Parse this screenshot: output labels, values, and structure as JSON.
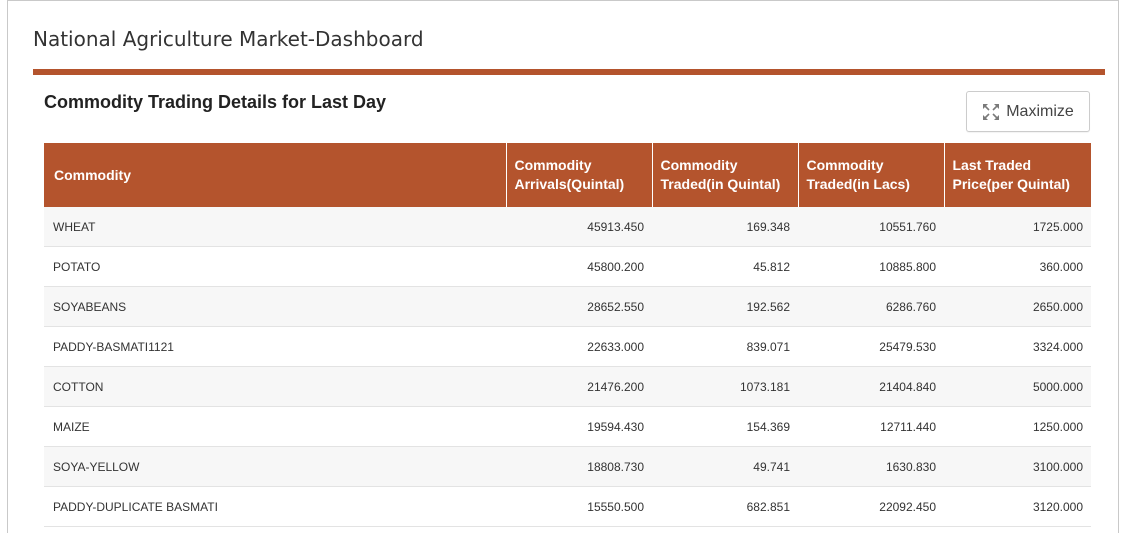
{
  "page": {
    "title": "National Agriculture Market-Dashboard"
  },
  "panel": {
    "title": "Commodity Trading Details for Last Day",
    "maximize_label": "Maximize",
    "maximize_icon": "expand-arrows-icon"
  },
  "colors": {
    "accent": "#b4542d"
  },
  "table": {
    "headers": [
      [
        "Commodity"
      ],
      [
        "Commodity",
        "Arrivals(Quintal)"
      ],
      [
        "Commodity",
        "Traded(in Quintal)"
      ],
      [
        "Commodity",
        "Traded(in Lacs)"
      ],
      [
        "Last Traded",
        "Price(per Quintal)"
      ]
    ],
    "rows": [
      [
        "WHEAT",
        "45913.450",
        "169.348",
        "10551.760",
        "1725.000"
      ],
      [
        "POTATO",
        "45800.200",
        "45.812",
        "10885.800",
        "360.000"
      ],
      [
        "SOYABEANS",
        "28652.550",
        "192.562",
        "6286.760",
        "2650.000"
      ],
      [
        "PADDY-BASMATI1121",
        "22633.000",
        "839.071",
        "25479.530",
        "3324.000"
      ],
      [
        "COTTON",
        "21476.200",
        "1073.181",
        "21404.840",
        "5000.000"
      ],
      [
        "MAIZE",
        "19594.430",
        "154.369",
        "12711.440",
        "1250.000"
      ],
      [
        "SOYA-YELLOW",
        "18808.730",
        "49.741",
        "1630.830",
        "3100.000"
      ],
      [
        "PADDY-DUPLICATE BASMATI",
        "15550.500",
        "682.851",
        "22092.450",
        "3120.000"
      ]
    ]
  }
}
